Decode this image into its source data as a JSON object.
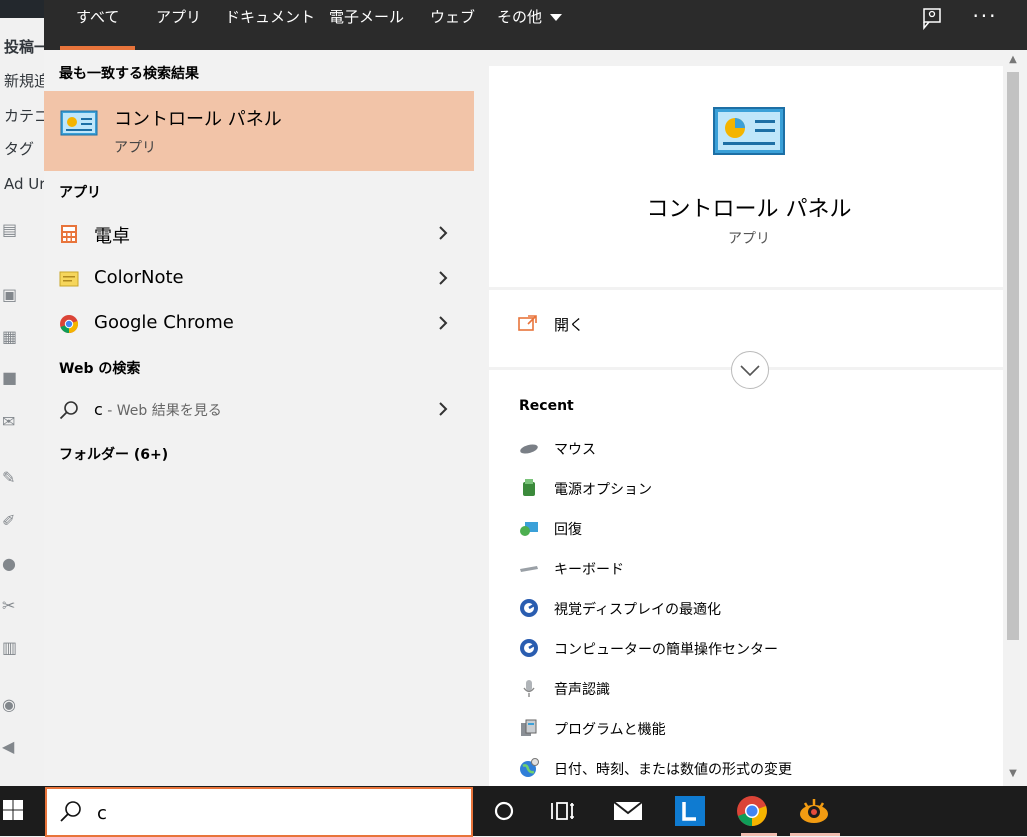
{
  "background_admin": {
    "rows": [
      "投稿一",
      "新規追",
      "カテゴ",
      "タグ",
      "Ad Ur"
    ]
  },
  "tabs": [
    {
      "label": "すべて",
      "active": true
    },
    {
      "label": "アプリ"
    },
    {
      "label": "ドキュメント"
    },
    {
      "label": "電子メール"
    },
    {
      "label": "ウェブ"
    },
    {
      "label": "その他"
    }
  ],
  "toolbar": {
    "more_options_label": "···"
  },
  "results": {
    "best_match_header": "最も一致する検索結果",
    "best_match": {
      "title": "コントロール パネル",
      "type": "アプリ",
      "icon": "control-panel-icon"
    },
    "apps_header": "アプリ",
    "apps": [
      {
        "label": "電卓",
        "icon": "calculator-icon"
      },
      {
        "label": "ColorNote",
        "icon": "sticky-note-icon"
      },
      {
        "label": "Google Chrome",
        "icon": "chrome-icon"
      }
    ],
    "web_header": "Web の検索",
    "web_item": {
      "query": "c",
      "suffix": " - Web 結果を見る",
      "icon": "search-icon"
    },
    "folders_header": "フォルダー (6+)"
  },
  "preview": {
    "title": "コントロール パネル",
    "type": "アプリ",
    "open_label": "開く",
    "recent_header": "Recent",
    "recent_items": [
      {
        "label": "マウス",
        "icon": "mouse-icon"
      },
      {
        "label": "電源オプション",
        "icon": "power-options-icon"
      },
      {
        "label": "回復",
        "icon": "recovery-icon"
      },
      {
        "label": "キーボード",
        "icon": "keyboard-icon"
      },
      {
        "label": "視覚ディスプレイの最適化",
        "icon": "ease-of-access-icon"
      },
      {
        "label": "コンピューターの簡単操作センター",
        "icon": "ease-of-access-icon"
      },
      {
        "label": "音声認識",
        "icon": "microphone-icon"
      },
      {
        "label": "プログラムと機能",
        "icon": "programs-icon"
      },
      {
        "label": "日付、時刻、または数値の形式の変更",
        "icon": "region-icon"
      }
    ]
  },
  "search": {
    "value": "c"
  },
  "taskbar": {
    "apps": [
      "cortana-icon",
      "task-view-icon",
      "mail-icon",
      "lens-app-icon",
      "chrome-icon",
      "photo-app-icon"
    ]
  },
  "colors": {
    "accent": "#e8743b",
    "best_match_bg": "#f2c4a8",
    "tab_bar": "#2b2b2b",
    "taskbar": "#1c1c1c"
  }
}
